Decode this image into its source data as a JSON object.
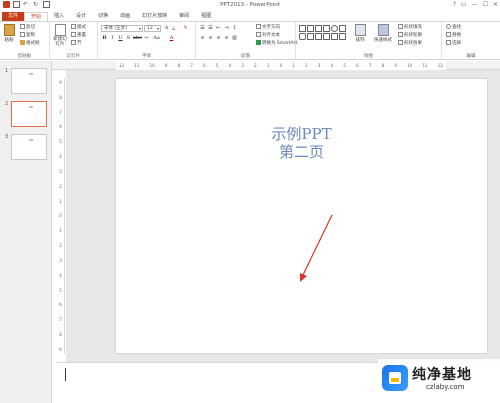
{
  "window": {
    "title": "PPT2013 - PowerPoint",
    "controls": [
      "?",
      "▭",
      "—",
      "☐",
      "✕"
    ]
  },
  "tabs": [
    "文件",
    "开始",
    "插入",
    "设计",
    "切换",
    "动画",
    "幻灯片放映",
    "审阅",
    "视图"
  ],
  "ribbon": {
    "clipboard": {
      "paste": "粘贴",
      "cut": "剪切",
      "copy": "复制",
      "format_painter": "格式刷",
      "label": "剪贴板"
    },
    "slides": {
      "new_slide": "新建幻灯片",
      "layout": "版式",
      "reset": "重置",
      "section": "节",
      "label": "幻灯片"
    },
    "font": {
      "family": "宋体 (正文)",
      "size": "12",
      "label": "字体"
    },
    "paragraph": {
      "text_direction": "文字方向",
      "align_text": "对齐文本",
      "smartart": "转换为 SmartArt",
      "label": "段落"
    },
    "drawing": {
      "arrange": "排列",
      "quick_styles": "快速样式",
      "shape_fill": "形状填充",
      "shape_outline": "形状轮廓",
      "shape_effects": "形状效果",
      "label": "绘图"
    },
    "editing": {
      "find": "查找",
      "replace": "替换",
      "select": "选择",
      "label": "编辑"
    }
  },
  "thumbnails": [
    {
      "number": "1",
      "active": false
    },
    {
      "number": "2",
      "active": true
    },
    {
      "number": "3",
      "active": false
    }
  ],
  "ruler": {
    "horizontal": [
      "12",
      "11",
      "10",
      "9",
      "8",
      "7",
      "6",
      "5",
      "4",
      "3",
      "2",
      "1",
      "0",
      "1",
      "2",
      "3",
      "4",
      "5",
      "6",
      "7",
      "8",
      "9",
      "10",
      "11",
      "12"
    ],
    "vertical": [
      "9",
      "8",
      "7",
      "6",
      "5",
      "4",
      "3",
      "2",
      "1",
      "0",
      "1",
      "2",
      "3",
      "4",
      "5",
      "6",
      "7",
      "8",
      "9"
    ]
  },
  "slide": {
    "title": "示例PPT",
    "subtitle": "第二页",
    "text_color": "#6c87b8",
    "arrow_color": "#d9332a"
  },
  "watermark": {
    "title": "纯净基地",
    "url": "czlaby.com"
  },
  "colors": {
    "accent": "#c43e1c"
  }
}
